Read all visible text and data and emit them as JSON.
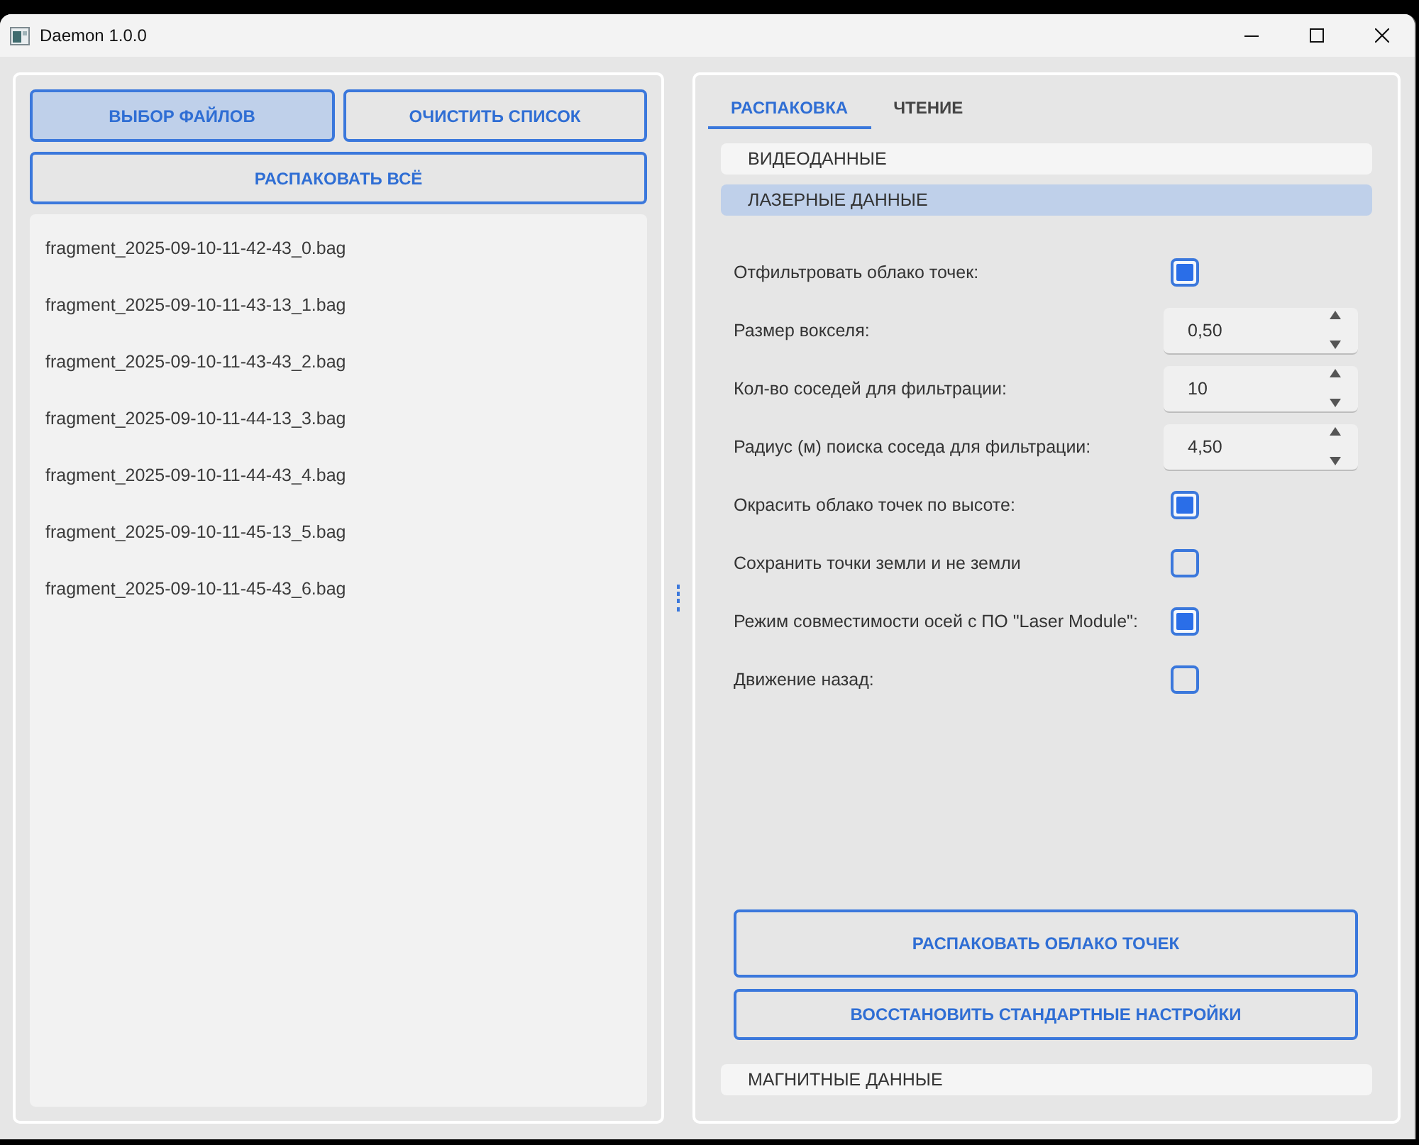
{
  "window": {
    "title": "Daemon 1.0.0"
  },
  "file_panel": {
    "buttons": [
      {
        "label": "ВЫБОР ФАЙЛОВ",
        "highlighted": true
      },
      {
        "label": "ОЧИСТИТЬ СПИСОК",
        "highlighted": false
      },
      {
        "label": "РАСПАКОВАТЬ ВСЁ",
        "highlighted": false
      }
    ],
    "files": [
      "fragment_2025-09-10-11-42-43_0.bag",
      "fragment_2025-09-10-11-43-13_1.bag",
      "fragment_2025-09-10-11-43-43_2.bag",
      "fragment_2025-09-10-11-44-13_3.bag",
      "fragment_2025-09-10-11-44-43_4.bag",
      "fragment_2025-09-10-11-45-13_5.bag",
      "fragment_2025-09-10-11-45-43_6.bag"
    ]
  },
  "tabs": [
    {
      "label": "РАСПАКОВКА",
      "selected": true
    },
    {
      "label": "ЧТЕНИЕ",
      "selected": false
    }
  ],
  "sections": [
    {
      "title": "ВИДЕОДАННЫЕ",
      "expanded": false
    },
    {
      "title": "ЛАЗЕРНЫЕ ДАННЫЕ",
      "expanded": true,
      "settings": [
        {
          "kind": "checkbox",
          "label": "Отфильтровать облако точек:",
          "checked": true
        },
        {
          "kind": "spinbox",
          "label": "Размер вокселя:",
          "value": "0,50"
        },
        {
          "kind": "spinbox",
          "label": "Кол-во соседей для фильтрации:",
          "value": "10"
        },
        {
          "kind": "spinbox",
          "label": "Радиус (м) поиска соседа для фильтрации:",
          "value": "4,50"
        },
        {
          "kind": "checkbox",
          "label": "Окрасить облако точек по высоте:",
          "checked": true
        },
        {
          "kind": "checkbox",
          "label": "Сохранить точки земли и не земли",
          "checked": false
        },
        {
          "kind": "checkbox",
          "label": "Режим совместимости осей с ПО \"Laser Module\":",
          "checked": true
        },
        {
          "kind": "checkbox",
          "label": "Движение назад:",
          "checked": false
        }
      ],
      "buttons": [
        {
          "label": "РАСПАКОВАТЬ ОБЛАКО ТОЧЕК"
        },
        {
          "label": "ВОССТАНОВИТЬ СТАНДАРТНЫЕ НАСТРОЙКИ"
        }
      ]
    },
    {
      "title": "МАГНИТНЫЕ ДАННЫЕ",
      "expanded": false
    }
  ]
}
